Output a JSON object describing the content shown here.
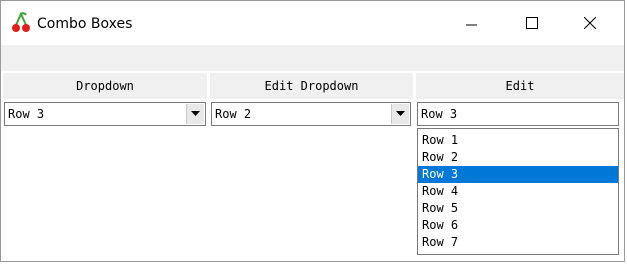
{
  "window": {
    "title": "Combo Boxes"
  },
  "titlebar_icons": [
    "cherry-app-icon",
    "minimize-icon",
    "maximize-icon",
    "close-icon"
  ],
  "columns": [
    {
      "header": "Dropdown",
      "value": "Row 3"
    },
    {
      "header": "Edit Dropdown",
      "value": "Row 2"
    },
    {
      "header": "Edit",
      "value": "Row 3"
    }
  ],
  "list": {
    "items": [
      "Row 1",
      "Row 2",
      "Row 3",
      "Row 4",
      "Row 5",
      "Row 6",
      "Row 7"
    ],
    "selected": "Row 3"
  },
  "colors": {
    "selection": "#0078d7",
    "header_bg": "#f0f0f0"
  }
}
